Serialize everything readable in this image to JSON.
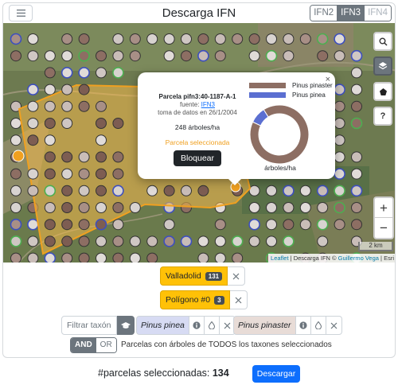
{
  "header": {
    "title": "Descarga IFN",
    "inventories": [
      {
        "label": "IFN2",
        "state": "normal"
      },
      {
        "label": "IFN3",
        "state": "active"
      },
      {
        "label": "IFN4",
        "state": "disabled"
      }
    ]
  },
  "map": {
    "controls": {
      "zoom_in": "+",
      "zoom_out": "−",
      "help": "?"
    },
    "scale": "2 km",
    "attribution": {
      "leaflet": "Leaflet",
      "rest": "| Descarga IFN ©",
      "author": "Guillermo Vega",
      "sep": "|",
      "tiles": "Esri"
    },
    "colors": {
      "selection_fill": "#f5b94a",
      "selection_border": "#f0a020",
      "pinaster": "#8d6e63",
      "pinea": "#5b6fd1"
    }
  },
  "popup": {
    "plot_id": "Parcela pifn3:40-1187-A-1",
    "source_label": "fuente:",
    "source_link": "IFN3",
    "date": "toma de datos en 26/1/2004",
    "trees": "248 árboles/ha",
    "selected_label": "Parcela seleccionada",
    "block_button": "Bloquear",
    "close": "×",
    "legend": [
      {
        "name": "Pinus pinaster",
        "color": "#8d6e63"
      },
      {
        "name": "Pinus pinea",
        "color": "#5b6fd1"
      }
    ],
    "chart_label": "árboles/ha"
  },
  "chart_data": {
    "type": "pie",
    "categories": [
      "Pinus pinaster",
      "Pinus pinea"
    ],
    "values": [
      91,
      9
    ],
    "title": "",
    "unit": "árboles/ha"
  },
  "filters": {
    "province": {
      "label": "Valladolid",
      "count": "131"
    },
    "polygon": {
      "label": "Polígono #0",
      "count": "3"
    },
    "taxon_placeholder": "Filtrar taxón",
    "taxa": [
      {
        "name": "Pinus pinea",
        "color": "#d7dbf3"
      },
      {
        "name": "Pinus pinaster",
        "color": "#e8dcd7"
      }
    ],
    "logic": {
      "and": "AND",
      "or": "OR",
      "description": "Parcelas con árboles de TODOS los taxones seleccionados"
    }
  },
  "footer": {
    "count_label": "#parcelas seleccionadas:",
    "count": "134",
    "download_button": "Descargar"
  }
}
